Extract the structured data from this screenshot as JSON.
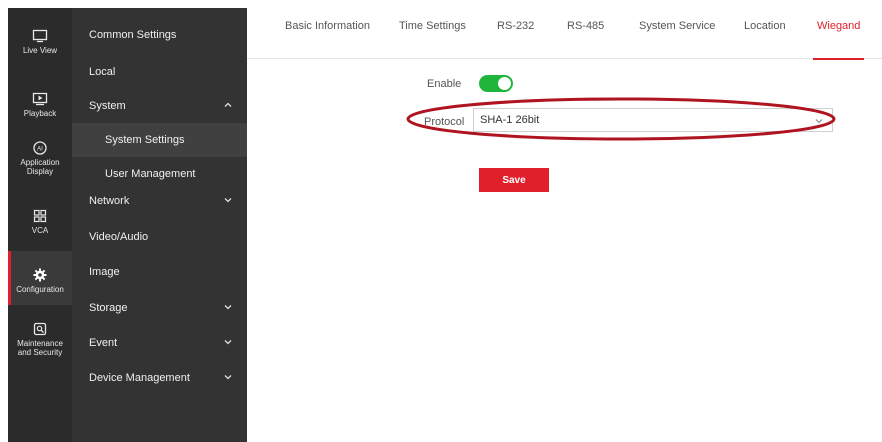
{
  "rail": {
    "items": [
      {
        "label": "Live View",
        "icon": "monitor-icon"
      },
      {
        "label": "Playback",
        "icon": "playback-icon"
      },
      {
        "label": "Application Display",
        "icon": "ai-icon"
      },
      {
        "label": "VCA",
        "icon": "vca-icon"
      },
      {
        "label": "Configuration",
        "icon": "gear-icon"
      },
      {
        "label": "Maintenance and Security",
        "icon": "maintenance-icon"
      }
    ],
    "active": "Configuration"
  },
  "menu": {
    "items": [
      {
        "label": "Common Settings"
      },
      {
        "label": "Local"
      },
      {
        "label": "System",
        "expanded": true
      },
      {
        "label": "System Settings",
        "sub": true,
        "selected": true
      },
      {
        "label": "User Management",
        "sub": true
      },
      {
        "label": "Network",
        "expanded": false
      },
      {
        "label": "Video/Audio"
      },
      {
        "label": "Image"
      },
      {
        "label": "Storage",
        "expanded": false
      },
      {
        "label": "Event",
        "expanded": false
      },
      {
        "label": "Device Management",
        "expanded": false
      }
    ]
  },
  "tabs": [
    {
      "label": "Basic Information"
    },
    {
      "label": "Time Settings"
    },
    {
      "label": "RS-232"
    },
    {
      "label": "RS-485"
    },
    {
      "label": "System Service"
    },
    {
      "label": "Location"
    },
    {
      "label": "Wiegand",
      "active": true
    }
  ],
  "form": {
    "enable_label": "Enable",
    "enable_value": true,
    "protocol_label": "Protocol",
    "protocol_value": "SHA-1 26bit",
    "save_label": "Save"
  },
  "colors": {
    "accent": "#e0202b",
    "toggle_on": "#1fb53a",
    "rail_bg": "#2b2b2b",
    "menu_bg": "#333333"
  }
}
